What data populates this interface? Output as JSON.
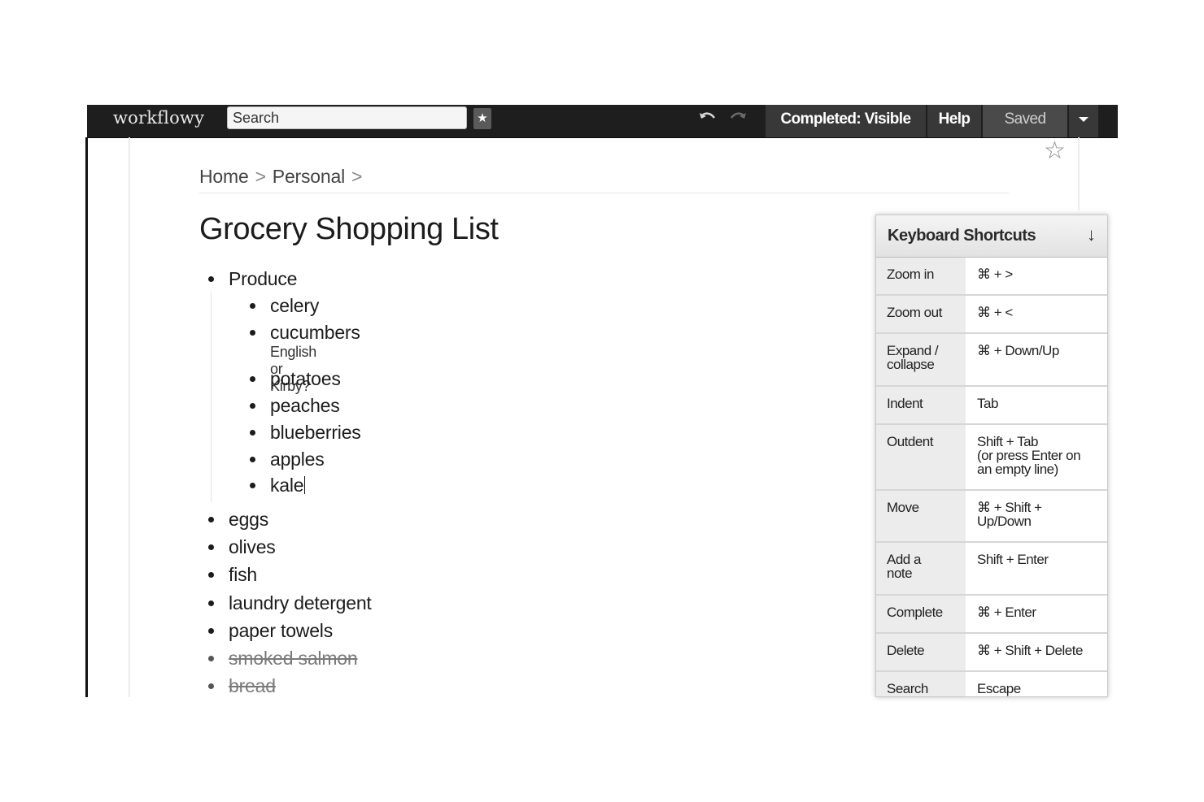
{
  "app": {
    "logo": "workflowy",
    "search_placeholder": "Search",
    "star_glyph": "★",
    "undo_icon": "undo-arrow-icon",
    "redo_icon": "redo-arrow-icon",
    "completed_label": "Completed: Visible",
    "help_label": "Help",
    "saved_label": "Saved",
    "menu_icon": "caret-down-icon"
  },
  "breadcrumb": {
    "items": [
      "Home",
      "Personal"
    ],
    "separator": ">"
  },
  "page": {
    "title": "Grocery Shopping List",
    "star_icon": "star-outline-icon",
    "star_glyph": "☆"
  },
  "outline": {
    "items": [
      {
        "text": "Produce",
        "completed": false,
        "children": [
          {
            "text": "celery"
          },
          {
            "text": "cucumbers",
            "note": "English or Kirby?"
          },
          {
            "text": "potatoes"
          },
          {
            "text": "peaches"
          },
          {
            "text": "blueberries"
          },
          {
            "text": "apples"
          },
          {
            "text": "kale",
            "editing": true
          }
        ]
      },
      {
        "text": "eggs",
        "completed": false
      },
      {
        "text": "olives",
        "completed": false
      },
      {
        "text": "fish",
        "completed": false
      },
      {
        "text": "laundry detergent",
        "completed": false
      },
      {
        "text": "paper towels",
        "completed": false
      },
      {
        "text": "smoked salmon",
        "completed": true
      },
      {
        "text": "bread",
        "completed": true
      }
    ]
  },
  "shortcuts": {
    "title": "Keyboard Shortcuts",
    "toggle_glyph": "↓",
    "rows": [
      {
        "action": "Zoom in",
        "keys": "⌘ + >"
      },
      {
        "action": "Zoom out",
        "keys": "⌘ + <"
      },
      {
        "action": "Expand /\ncollapse",
        "keys": "⌘ + Down/Up"
      },
      {
        "action": "Indent",
        "keys": "Tab"
      },
      {
        "action": "Outdent",
        "keys": "Shift + Tab\n(or press Enter on\nan empty line)"
      },
      {
        "action": "Move",
        "keys": "⌘ + Shift +\nUp/Down"
      },
      {
        "action": "Add a\nnote",
        "keys": "Shift + Enter"
      },
      {
        "action": "Complete",
        "keys": "⌘ + Enter"
      },
      {
        "action": "Delete",
        "keys": "⌘ + Shift + Delete"
      },
      {
        "action": "Search",
        "keys": "Escape"
      }
    ]
  }
}
